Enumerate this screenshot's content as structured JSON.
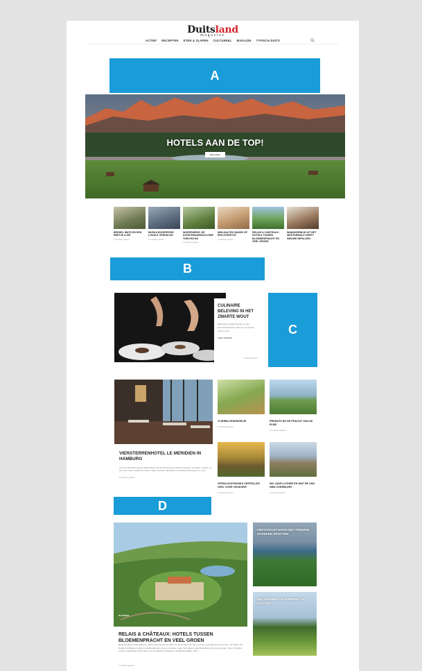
{
  "brand": {
    "logo_main": "Duits",
    "logo_accent": "land",
    "logo_sub": "magazine",
    "accent_color": "#d2242c"
  },
  "nav": {
    "items": [
      "ACTIEF",
      "RECEPTEN",
      "ETEN & SLAPEN",
      "CULTUREEL",
      "MAGAZIN",
      "TYPISCH DUITS"
    ],
    "search_icon": "search-icon"
  },
  "labels": {
    "a": "A",
    "b": "B",
    "c": "C",
    "d": "D",
    "color": "#1a9cd8"
  },
  "hero": {
    "title": "HOTELS AAN DE TOP!",
    "button": "BEKIJKEN"
  },
  "thumbs": [
    {
      "title": "BEDDEL WATD EN EEN BEETJE LUXE",
      "date": "8 maanden geleden"
    },
    {
      "title": "MUSKA BOGERVEKE LOKALE VERHALEN",
      "date": "8 maanden geleden"
    },
    {
      "title": "WORPSWEDE: DE KUNSTENAARSKOLONIE TOEN EN NU",
      "date": "9 maanden geleden"
    },
    {
      "title": "MINI-HALTED HUNDE OP EEN STEEETJE",
      "date": "9 maanden geleden"
    },
    {
      "title": "RELAIS & CHÂTEAUX: HOTELS TUSSEN BLOEMENPRACHT EN VEEL GROEN",
      "date": ""
    },
    {
      "title": "WANDKERNKID UIT HET WESTERWALD GEEFT NIEUWE IMPULSEN",
      "date": ""
    }
  ],
  "featured": {
    "title": "CULINAIRE BELEVING IN HET ZWARTE WOUT",
    "excerpt": "Baiersbronn staat bekend om zijn sterrenrestaurants. Dat is in de keuken goed te zien.",
    "more": "LEES VERDER",
    "date": "5 maanden 2023"
  },
  "big_article": {
    "title": "VIERSTERRENHOTEL LE MERIDIEN IN HAMBURG",
    "excerpt": "In het Le Meridien aan de Buitenalster kun je Hamburg op zijn best beleven: voortaan, modern en, voor de moeite oefperde hoteles. Vakse dromfer Lanparticis entreflebe Wehrenteen en rust.",
    "date": "8 maanden geleden"
  },
  "small_articles": [
    {
      "title": "VLIERBLOESEMGELEI",
      "date": "8 maanden geleden"
    },
    {
      "title": "PRIGNITZ EN DE PRACHT VAN DE ELBE",
      "date": "10 maanden geleden"
    },
    {
      "title": "OPENLUCHTMUSEA VERTELLEN VEEL OVER VROEGER",
      "date": "8 maanden geleden"
    },
    {
      "title": "500 JAAR LUTHER EN WAT ER VAN HEM OVERBLEEF",
      "date": "9 maanden geleden"
    }
  ],
  "section_d": {
    "tag": "BLOEMEN",
    "title": "RELAIS & CHÂTEAUX: HOTELS TUSSEN BLOEMENPRACHT EN VEEL GROEN",
    "excerpt": "Bij Spa's gerenomde gastens, perfect geschende vervallen en hoort Nemmen die zo uit een sprookje kunnen komen: de hotels van Relais & Châteaux hebben indrukwekkende tuinen en parken, waar men alleen natuurliefhebbers komen genieten. Twee: Woeltler Lucas op Balthazar Duits katten van de Relais & Châteaux verrijdingen liggen: alle n",
    "date": "9 maanden geleden",
    "side_1": "FIETSTOCHT DOOR HET FRIEZEN SCHEPEN SPOTTEN",
    "side_2": "HET KRAMBACH VERWENT DE GASTEN"
  }
}
